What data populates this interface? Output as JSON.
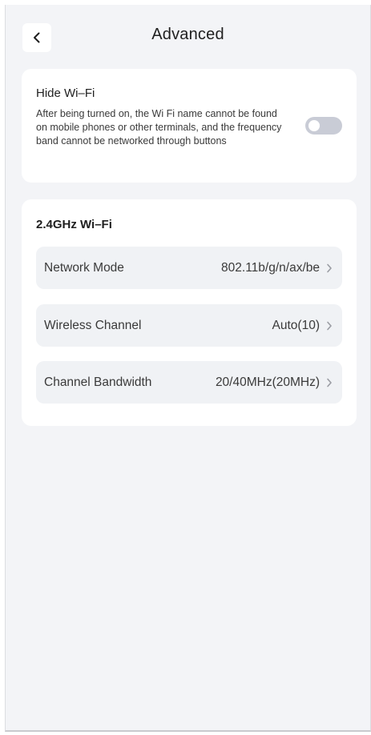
{
  "header": {
    "title": "Advanced",
    "back_icon": "chevron-left-icon"
  },
  "hide_wifi": {
    "title": "Hide Wi–Fi",
    "description": "After being turned on, the Wi Fi name cannot be found on mobile phones or other terminals, and the frequency band cannot be networked through buttons",
    "toggle_on": false
  },
  "wifi_24": {
    "section_title": "2.4GHz Wi–Fi",
    "rows": [
      {
        "label": "Network Mode",
        "value": "802.11b/g/n/ax/be"
      },
      {
        "label": "Wireless Channel",
        "value": "Auto(10)"
      },
      {
        "label": "Channel Bandwidth",
        "value": "20/40MHz(20MHz)"
      }
    ]
  },
  "colors": {
    "background": "#f3f4f7",
    "card": "#ffffff",
    "row_bg": "#f0f2f5",
    "toggle_off": "#c9ccd6"
  }
}
